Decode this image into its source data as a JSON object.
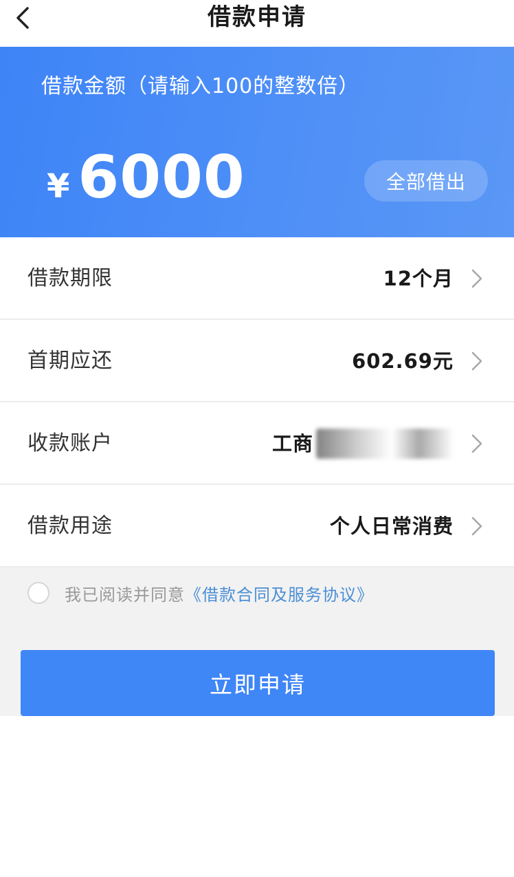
{
  "header": {
    "title": "借款申请",
    "back_icon": "chevron-left-icon"
  },
  "amount_banner": {
    "hint": "借款金额（请输入100的整数倍）",
    "currency_symbol": "¥",
    "amount": "6000",
    "borrow_all_label": "全部借出"
  },
  "form": {
    "rows": [
      {
        "label": "借款期限",
        "value": "12个月"
      },
      {
        "label": "首期应还",
        "value": "602.69元"
      },
      {
        "label": "收款账户",
        "value": "工商"
      },
      {
        "label": "借款用途",
        "value": "个人日常消费"
      }
    ]
  },
  "agreement": {
    "prefix": "我已阅读并同意",
    "link": "《借款合同及服务协议》",
    "checked": false
  },
  "submit": {
    "label": "立即申请"
  },
  "colors": {
    "brand_blue": "#3f86f6",
    "link_blue": "#4a8fd6",
    "page_gray": "#f2f2f2"
  }
}
